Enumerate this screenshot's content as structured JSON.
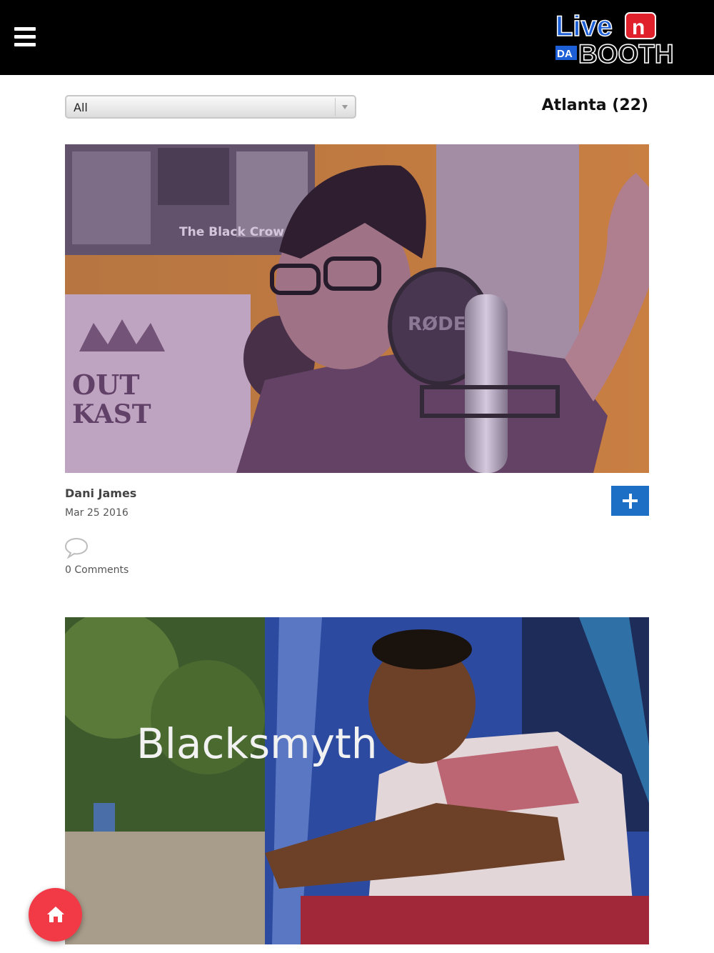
{
  "header": {
    "menu_icon": "hamburger-menu-icon",
    "logo": {
      "line1": "Live",
      "badge": "n",
      "line2_prefix": "DA",
      "line2": "BOOTH",
      "colors": {
        "blue": "#1d5fd6",
        "red": "#e0202a"
      }
    }
  },
  "filter": {
    "selected": "All"
  },
  "city": {
    "label": "Atlanta (22)"
  },
  "posts": [
    {
      "artist": "Dani James",
      "date": "Mar 25 2016",
      "comments_label": "0 Comments",
      "image_texts": {
        "poster": "The Black Crow",
        "logo_line1": "OUT",
        "logo_line2": "KAST",
        "mic_brand": "RØDE"
      }
    },
    {
      "image_overlay_title": "Blacksmyth"
    }
  ],
  "fab": {
    "icon": "home-icon",
    "color": "#f23a47"
  },
  "accent_color": "#1d6fc6"
}
